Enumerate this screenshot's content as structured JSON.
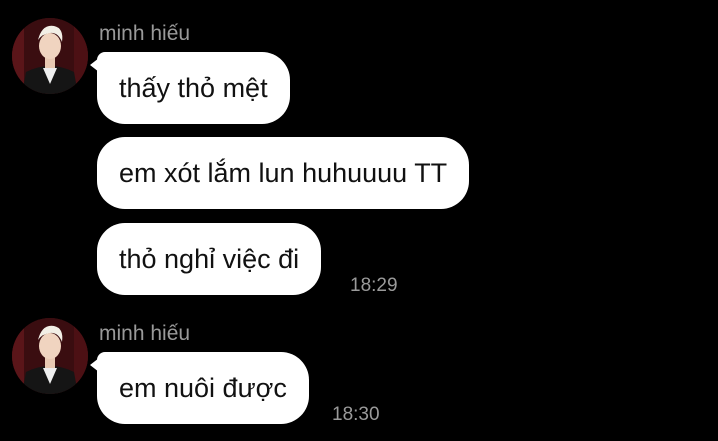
{
  "colors": {
    "background": "#000000",
    "bubble": "#ffffff",
    "text": "#111111",
    "meta": "#9a9a9a"
  },
  "groups": [
    {
      "sender": "minh hiếu",
      "messages": [
        {
          "text": "thấy thỏ mệt"
        },
        {
          "text": "em xót lắm lun huhuuuu TT"
        },
        {
          "text": "thỏ nghỉ việc đi",
          "time": "18:29"
        }
      ]
    },
    {
      "sender": "minh hiếu",
      "messages": [
        {
          "text": "em nuôi được",
          "time": "18:30"
        }
      ]
    }
  ]
}
